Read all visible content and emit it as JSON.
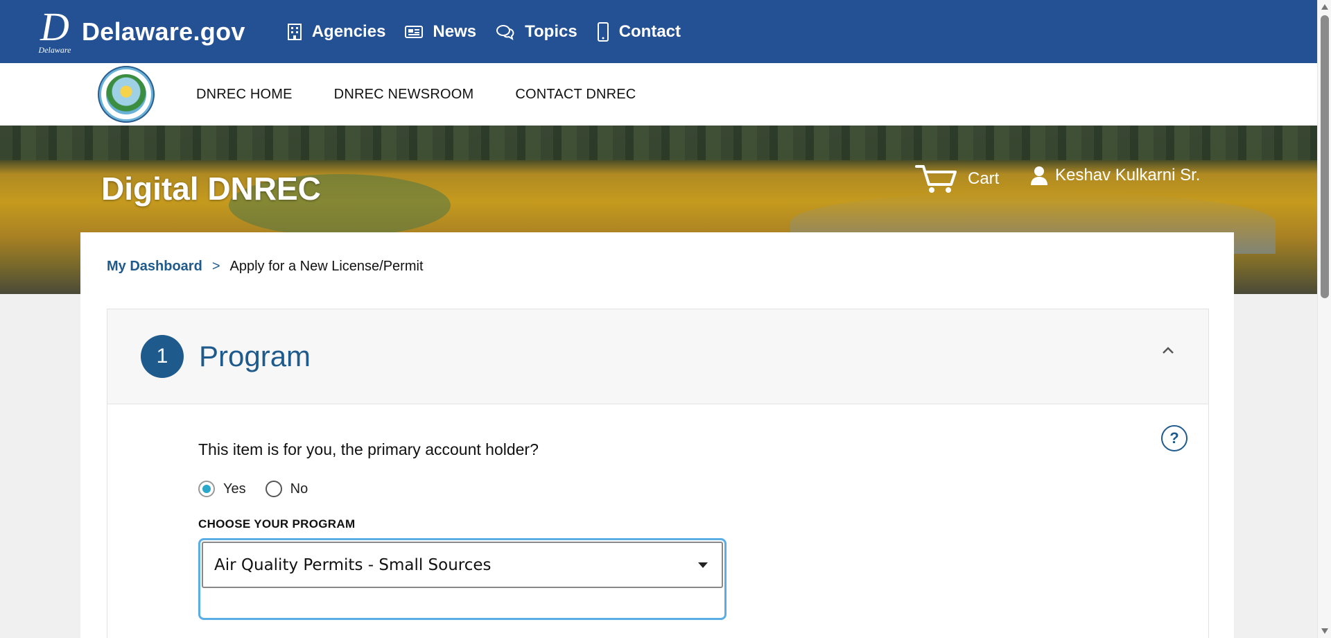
{
  "state_bar": {
    "logo_mark": "D",
    "logo_subtext": "Delaware",
    "logo_text": "Delaware.gov",
    "nav": [
      {
        "label": "Agencies",
        "icon": "building-icon"
      },
      {
        "label": "News",
        "icon": "newspaper-icon"
      },
      {
        "label": "Topics",
        "icon": "chat-bubbles-icon"
      },
      {
        "label": "Contact",
        "icon": "mobile-phone-icon"
      }
    ]
  },
  "agency_bar": {
    "seal_alt": "DNREC seal",
    "nav": [
      "DNREC HOME",
      "DNREC NEWSROOM",
      "CONTACT DNREC"
    ]
  },
  "hero": {
    "title": "Digital DNREC",
    "cart_label": "Cart",
    "user_name": "Keshav Kulkarni Sr."
  },
  "breadcrumb": {
    "link": "My Dashboard",
    "separator": ">",
    "current": "Apply for a New License/Permit"
  },
  "step": {
    "number": "1",
    "title": "Program",
    "help_label": "?",
    "question": "This item is for you, the primary account holder?",
    "options": [
      {
        "label": "Yes",
        "checked": true
      },
      {
        "label": "No",
        "checked": false
      }
    ],
    "program_label": "CHOOSE YOUR PROGRAM",
    "program_selected": "Air Quality Permits - Small Sources"
  },
  "colors": {
    "state_blue": "#245193",
    "accent_blue": "#1f5a8c",
    "radio_checked": "#2aa7c9",
    "focus_ring": "#5aaee6"
  }
}
